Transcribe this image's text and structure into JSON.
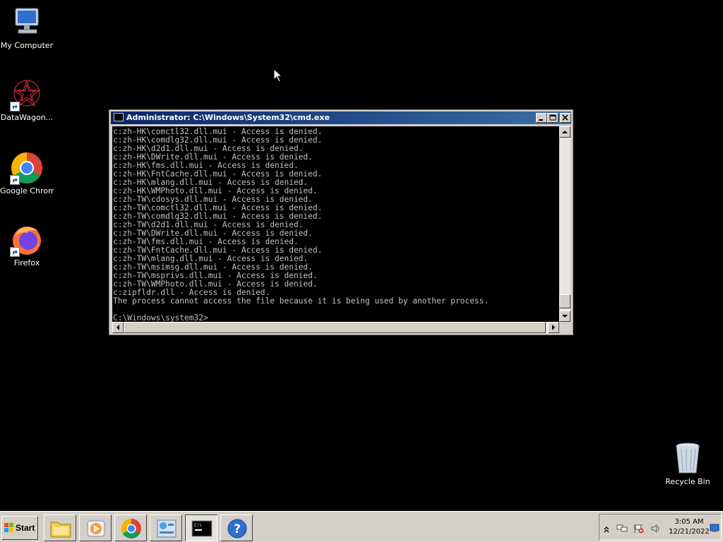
{
  "desktop": {
    "icons": [
      {
        "label": "My Computer"
      },
      {
        "label": "DataWagon..."
      },
      {
        "label": "Google Chrome"
      },
      {
        "label": "Firefox"
      }
    ],
    "recycle_bin": {
      "label": "Recycle Bin"
    }
  },
  "cmd_window": {
    "title": "Administrator: C:\\Windows\\System32\\cmd.exe",
    "lines": [
      "c:zh-HK\\comctl32.dll.mui - Access is denied.",
      "c:zh-HK\\comdlg32.dll.mui - Access is denied.",
      "c:zh-HK\\d2d1.dll.mui - Access is denied.",
      "c:zh-HK\\DWrite.dll.mui - Access is denied.",
      "c:zh-HK\\fms.dll.mui - Access is denied.",
      "c:zh-HK\\FntCache.dll.mui - Access is denied.",
      "c:zh-HK\\mlang.dll.mui - Access is denied.",
      "c:zh-HK\\WMPhoto.dll.mui - Access is denied.",
      "c:zh-TW\\cdosys.dll.mui - Access is denied.",
      "c:zh-TW\\comctl32.dll.mui - Access is denied.",
      "c:zh-TW\\comdlg32.dll.mui - Access is denied.",
      "c:zh-TW\\d2d1.dll.mui - Access is denied.",
      "c:zh-TW\\DWrite.dll.mui - Access is denied.",
      "c:zh-TW\\fms.dll.mui - Access is denied.",
      "c:zh-TW\\FntCache.dll.mui - Access is denied.",
      "c:zh-TW\\mlang.dll.mui - Access is denied.",
      "c:zh-TW\\msimsg.dll.mui - Access is denied.",
      "c:zh-TW\\msprivs.dll.mui - Access is denied.",
      "c:zh-TW\\WMPhoto.dll.mui - Access is denied.",
      "c:zipfldr.dll - Access is denied.",
      "The process cannot access the file because it is being used by another process.",
      "",
      "C:\\Windows\\system32>"
    ]
  },
  "taskbar": {
    "start_label": "Start",
    "buttons": [
      {
        "icon": "folder-icon"
      },
      {
        "icon": "media-player-icon"
      },
      {
        "icon": "chrome-icon"
      },
      {
        "icon": "control-panel-icon"
      },
      {
        "icon": "cmd-icon",
        "active": true
      },
      {
        "icon": "help-icon"
      }
    ],
    "clock": {
      "time": "3:05 AM",
      "date": "12/21/2022"
    }
  },
  "colors": {
    "desktop_bg": "#000000",
    "titlebar": "#0a246a",
    "console_text": "#c0c0c0",
    "taskbar": "#d4d0c8"
  }
}
